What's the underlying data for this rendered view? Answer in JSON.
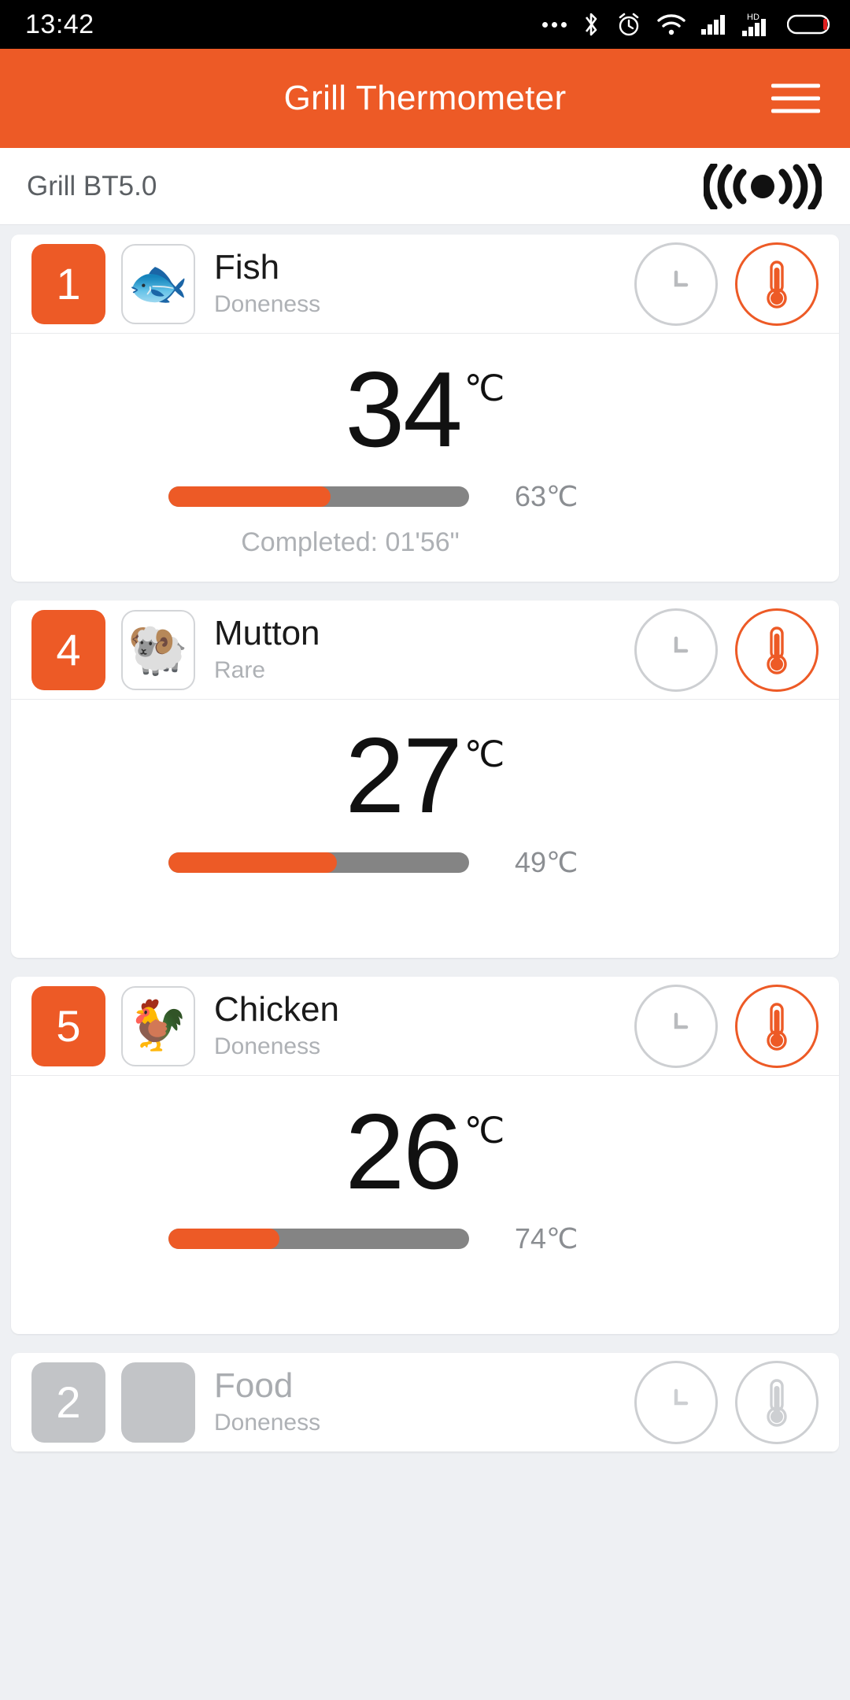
{
  "status_bar": {
    "time": "13:42",
    "icons": [
      "more-dots-icon",
      "bluetooth-icon",
      "alarm-clock-icon",
      "wifi-icon",
      "cellular-signal-icon",
      "hd-signal-icon",
      "battery-icon"
    ]
  },
  "header": {
    "title": "Grill Thermometer",
    "menu_icon": "hamburger-menu-icon"
  },
  "device": {
    "name": "Grill BT5.0",
    "signal_icon": "bluetooth-broadcast-icon"
  },
  "colors": {
    "accent": "#ED5A26",
    "bar_track": "#848484",
    "muted": "#aeb1b5",
    "disabled": "#c2c4c7"
  },
  "probes": [
    {
      "badge": "1",
      "food_icon": "fish-icon",
      "food_glyph": "🐟",
      "name": "Fish",
      "doneness": "Doneness",
      "clock_icon": "clock-icon",
      "thermo_icon": "thermometer-icon",
      "active": true,
      "current_temp": "34",
      "unit": "℃",
      "progress_percent": 54,
      "target_temp": "63℃",
      "completed": "Completed: 01'56\""
    },
    {
      "badge": "4",
      "food_icon": "ram-icon",
      "food_glyph": "🐏",
      "name": "Mutton",
      "doneness": "Rare",
      "clock_icon": "clock-icon",
      "thermo_icon": "thermometer-icon",
      "active": true,
      "current_temp": "27",
      "unit": "℃",
      "progress_percent": 56,
      "target_temp": "49℃",
      "completed": ""
    },
    {
      "badge": "5",
      "food_icon": "rooster-icon",
      "food_glyph": "🐓",
      "name": "Chicken",
      "doneness": "Doneness",
      "clock_icon": "clock-icon",
      "thermo_icon": "thermometer-icon",
      "active": true,
      "current_temp": "26",
      "unit": "℃",
      "progress_percent": 37,
      "target_temp": "74℃",
      "completed": ""
    },
    {
      "badge": "2",
      "food_icon": "empty-food-icon",
      "food_glyph": "",
      "name": "Food",
      "doneness": "Doneness",
      "clock_icon": "clock-icon",
      "thermo_icon": "thermometer-icon",
      "active": false,
      "current_temp": "",
      "unit": "℃",
      "progress_percent": 0,
      "target_temp": "",
      "completed": ""
    }
  ]
}
